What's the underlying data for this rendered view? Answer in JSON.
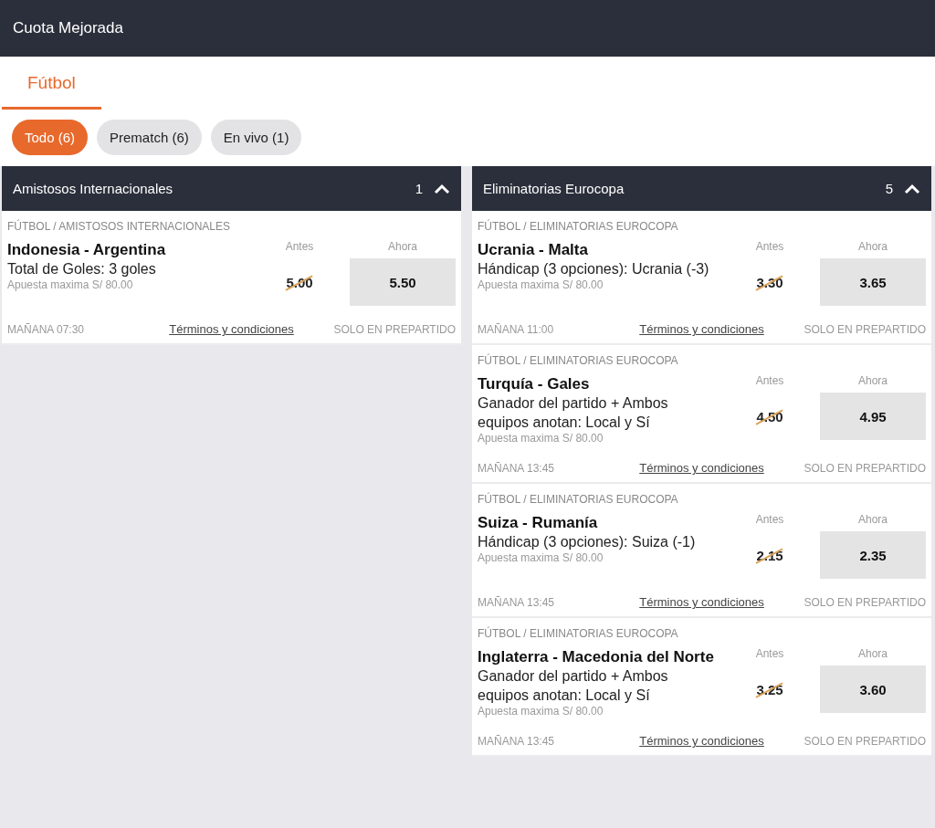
{
  "header": {
    "title": "Cuota Mejorada"
  },
  "tabs": [
    {
      "label": "Fútbol",
      "selected": true
    }
  ],
  "filters": [
    {
      "label": "Todo (6)",
      "selected": true
    },
    {
      "label": "Prematch (6)",
      "selected": false
    },
    {
      "label": "En vivo (1)",
      "selected": false
    }
  ],
  "sections": [
    {
      "title": "Amistosos Internacionales",
      "count": "1",
      "expanded": true,
      "events": [
        {
          "breadcrumb": "FÚTBOL / AMISTOSOS INTERNACIONALES",
          "match": "Indonesia - Argentina",
          "market": "Total de Goles: 3 goles",
          "max_bet": "Apuesta maxima S/ 80.00",
          "before_label": "Antes",
          "before": "5.00",
          "now_label": "Ahora",
          "now": "5.50",
          "time": "MAÑANA 07:30",
          "terms": "Términos y condiciones",
          "note": "SOLO EN PREPARTIDO"
        }
      ]
    },
    {
      "title": "Eliminatorias Eurocopa",
      "count": "5",
      "expanded": true,
      "events": [
        {
          "breadcrumb": "FÚTBOL / ELIMINATORIAS EUROCOPA",
          "match": "Ucrania - Malta",
          "market": "Hándicap (3 opciones): Ucrania (-3)",
          "max_bet": "Apuesta maxima S/ 80.00",
          "before_label": "Antes",
          "before": "3.30",
          "now_label": "Ahora",
          "now": "3.65",
          "time": "MAÑANA 11:00",
          "terms": "Términos y condiciones",
          "note": "SOLO EN PREPARTIDO"
        },
        {
          "breadcrumb": "FÚTBOL / ELIMINATORIAS EUROCOPA",
          "match": "Turquía - Gales",
          "market": "Ganador del partido + Ambos equipos anotan: Local y Sí",
          "max_bet": "Apuesta maxima S/ 80.00",
          "before_label": "Antes",
          "before": "4.50",
          "now_label": "Ahora",
          "now": "4.95",
          "time": "MAÑANA 13:45",
          "terms": "Términos y condiciones",
          "note": "SOLO EN PREPARTIDO"
        },
        {
          "breadcrumb": "FÚTBOL / ELIMINATORIAS EUROCOPA",
          "match": "Suiza - Rumanía",
          "market": "Hándicap (3 opciones): Suiza (-1)",
          "max_bet": "Apuesta maxima S/ 80.00",
          "before_label": "Antes",
          "before": "2.15",
          "now_label": "Ahora",
          "now": "2.35",
          "time": "MAÑANA 13:45",
          "terms": "Términos y condiciones",
          "note": "SOLO EN PREPARTIDO"
        },
        {
          "breadcrumb": "FÚTBOL / ELIMINATORIAS EUROCOPA",
          "match": "Inglaterra - Macedonia del Norte",
          "market": "Ganador del partido + Ambos equipos anotan: Local y Sí",
          "max_bet": "Apuesta maxima S/ 80.00",
          "before_label": "Antes",
          "before": "3.25",
          "now_label": "Ahora",
          "now": "3.60",
          "time": "MAÑANA 13:45",
          "terms": "Términos y condiciones",
          "note": "SOLO EN PREPARTIDO"
        }
      ]
    }
  ]
}
